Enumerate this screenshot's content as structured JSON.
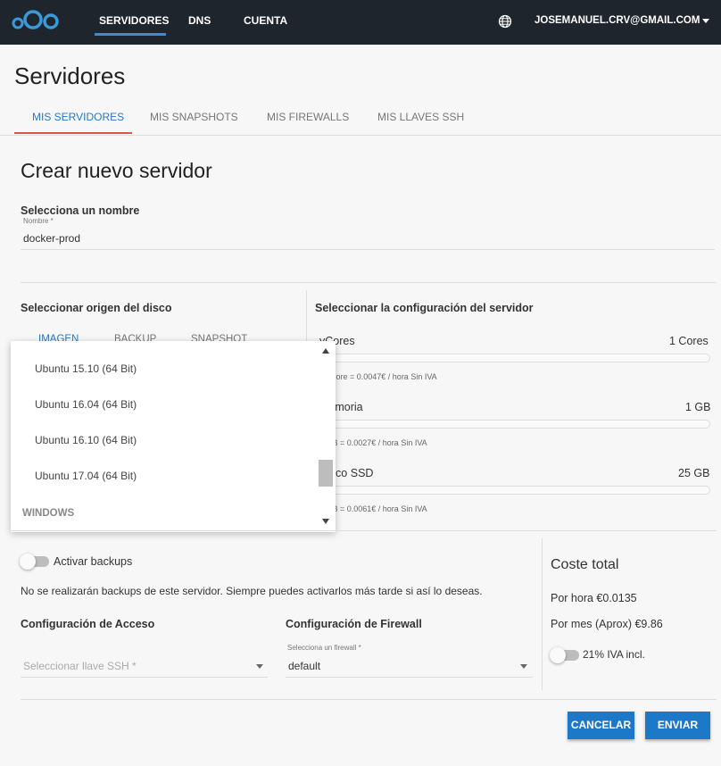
{
  "topbar": {
    "nav": [
      "SERVIDORES",
      "DNS",
      "CUENTA"
    ],
    "user_email": "JOSEMANUEL.CRV@GMAIL.COM"
  },
  "page": {
    "title": "Servidores",
    "tabs": [
      "MIS SERVIDORES",
      "MIS SNAPSHOTS",
      "MIS FIREWALLS",
      "MIS LLAVES SSH"
    ]
  },
  "create": {
    "title": "Crear nuevo servidor",
    "name_section": "Selecciona un nombre",
    "name_field_label": "Nombre *",
    "name_value": "docker-prod"
  },
  "disk": {
    "title": "Seleccionar origen del disco",
    "tabs": [
      "IMAGEN",
      "BACKUP",
      "SNAPSHOT"
    ],
    "dropdown_items": [
      "Ubuntu 15.10 (64 Bit)",
      "Ubuntu 16.04 (64 Bit)",
      "Ubuntu 16.10 (64 Bit)",
      "Ubuntu 17.04 (64 Bit)"
    ],
    "dropdown_group": "WINDOWS"
  },
  "config": {
    "title": "Seleccionar la configuración del servidor",
    "vcores_label": "vCores",
    "vcores_value": "1 Cores",
    "vcores_price": "1 vCore = 0.0047€ / hora Sin IVA",
    "memory_label": "Memoria",
    "memory_value": "1 GB",
    "memory_price": "1 GB = 0.0027€ / hora Sin IVA",
    "disk_label": "Disco SSD",
    "disk_value": "25 GB",
    "disk_price": "1 GB = 0.0061€ / hora Sin IVA"
  },
  "backups": {
    "toggle_label": "Activar backups",
    "note": "No se realizarán backups de este servidor. Siempre puedes activarlos más tarde si así lo deseas."
  },
  "access": {
    "title": "Configuración de Acceso",
    "ssh_placeholder": "Seleccionar llave SSH *"
  },
  "firewall": {
    "title": "Configuración de Firewall",
    "field_label": "Selecciona un firewall *",
    "value": "default"
  },
  "cost": {
    "title": "Coste total",
    "per_hour": "Por hora €0.0135",
    "per_month": "Por mes (Aprox) €9.86",
    "iva_label": "21% IVA incl."
  },
  "actions": {
    "cancel": "CANCELAR",
    "submit": "ENVIAR"
  },
  "colors": {
    "topbar": "#1f252d",
    "accent": "#1e78c8",
    "tab_underline": "#d9534f",
    "logo": "#3a9ad9"
  }
}
